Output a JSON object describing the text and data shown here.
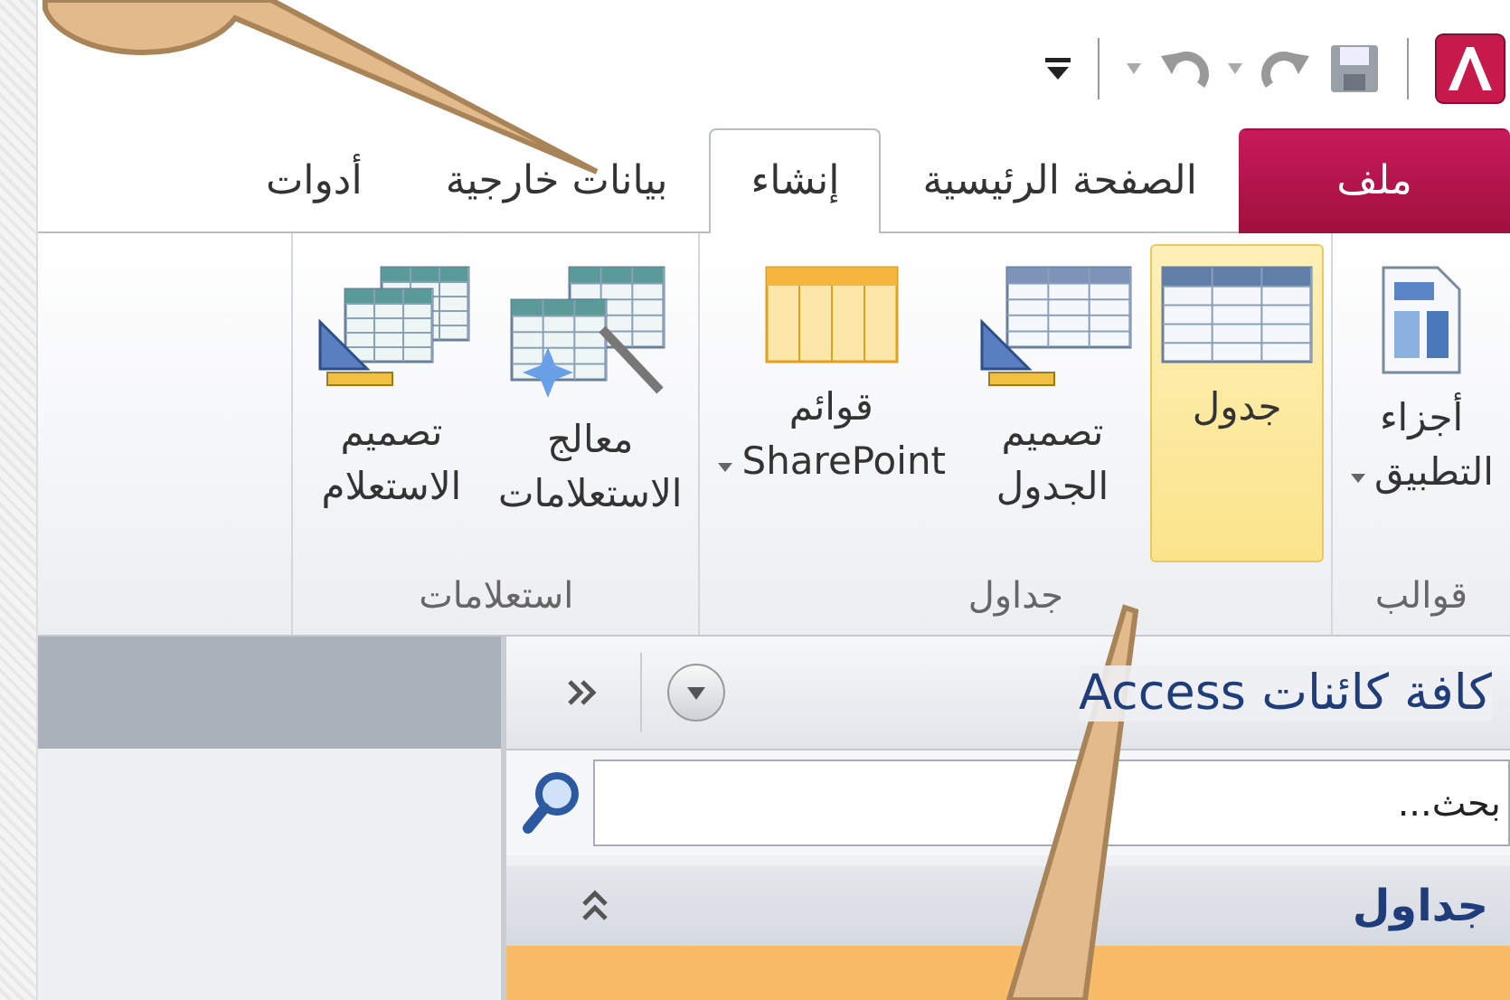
{
  "tabs": [
    {
      "label": "ملف",
      "kind": "file",
      "selected": false
    },
    {
      "label": "الصفحة الرئيسية",
      "kind": "tab",
      "selected": false
    },
    {
      "label": "إنشاء",
      "kind": "tab",
      "selected": true
    },
    {
      "label": "بيانات خارجية",
      "kind": "tab",
      "selected": false
    },
    {
      "label": "أدوات",
      "kind": "tab",
      "selected": false
    }
  ],
  "ribbon": {
    "groups": [
      {
        "label": "قوالب",
        "buttons": [
          {
            "label": "أجزاء\nالتطبيق",
            "kind": "parts",
            "dropdown": true,
            "selected": false
          }
        ]
      },
      {
        "label": "جداول",
        "buttons": [
          {
            "label": "جدول",
            "kind": "table",
            "dropdown": false,
            "selected": true
          },
          {
            "label": "تصميم\nالجدول",
            "kind": "table-design",
            "dropdown": false,
            "selected": false
          },
          {
            "label": "قوائم\nSharePoint",
            "kind": "list",
            "dropdown": true,
            "selected": false
          }
        ]
      },
      {
        "label": "استعلامات",
        "buttons": [
          {
            "label": "معالج\nالاستعلامات",
            "kind": "wizard",
            "dropdown": false,
            "selected": false
          },
          {
            "label": "تصميم\nالاستعلام",
            "kind": "query-design",
            "dropdown": false,
            "selected": false
          }
        ]
      }
    ]
  },
  "nav_pane": {
    "title": "كافة كائنات Access",
    "search": {
      "placeholder": "بحث..."
    },
    "groups": [
      {
        "label": "جداول",
        "expanded": true
      }
    ],
    "items": [
      {
        "selected": true
      }
    ]
  }
}
